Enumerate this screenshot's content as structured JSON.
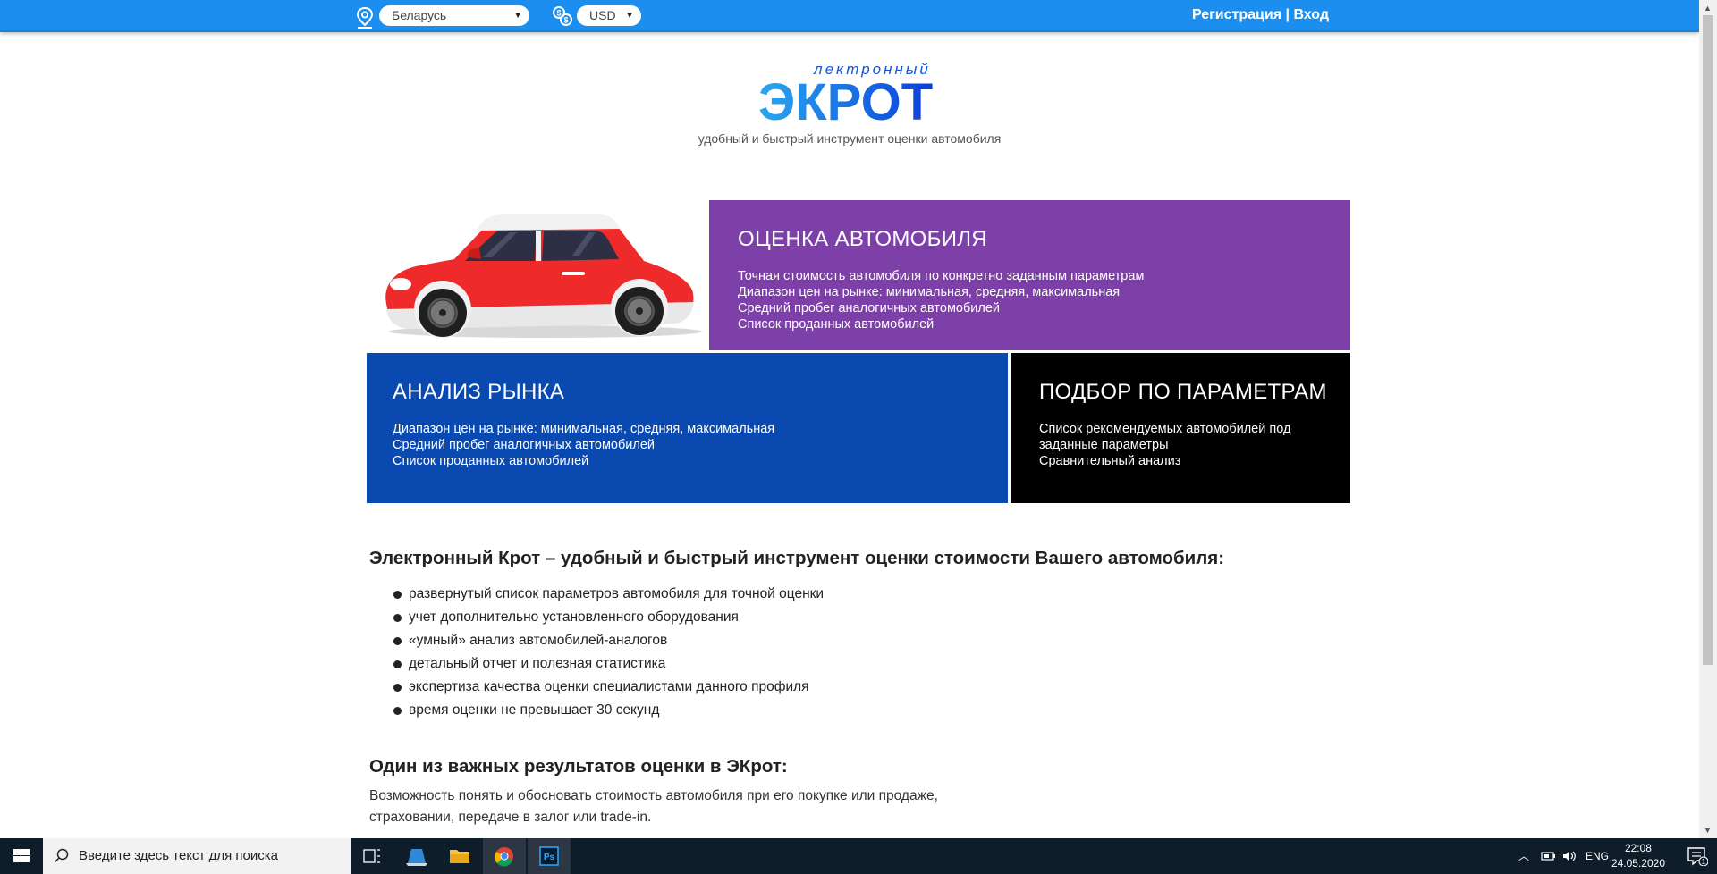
{
  "topbar": {
    "country": "Беларусь",
    "currency": "USD",
    "register_label": "Регистрация",
    "separator": " | ",
    "login_label": "Вход"
  },
  "logo": {
    "small_text": "лектронный",
    "big_text": "ЭКРОТ",
    "tagline": "удобный и быстрый инструмент оценки автомобиля"
  },
  "tiles": [
    {
      "title": "ОЦЕНКА АВТОМОБИЛЯ",
      "lines": [
        "Точная стоимость автомобиля по конкретно заданным параметрам",
        "Диапазон цен на рынке: минимальная, средняя, максимальная",
        "Средний пробег аналогичных автомобилей",
        "Список проданных автомобилей"
      ],
      "color": "#7d3fa8"
    },
    {
      "title": "АНАЛИЗ РЫНКА",
      "lines": [
        "Диапазон цен на рынке: минимальная, средняя, максимальная",
        "Средний пробег аналогичных автомобилей",
        "Список проданных автомобилей"
      ],
      "color": "#0a49b0"
    },
    {
      "title": "ПОДБОР ПО ПАРАМЕТРАМ",
      "lines": [
        "Список рекомендуемых автомобилей под",
        "заданные параметры",
        "Сравнительный анализ"
      ],
      "color": "#000000"
    }
  ],
  "content": {
    "heading1": "Электронный Крот – удобный и быстрый инструмент оценки стоимости Вашего автомобиля:",
    "features": [
      "развернутый список параметров автомобиля для точной оценки",
      "учет дополнительно установленного оборудования",
      "«умный» анализ автомобилей-аналогов",
      "детальный отчет и полезная статистика",
      "экспертиза качества оценки специалистами данного профиля",
      "время оценки не превышает 30 секунд"
    ],
    "heading2": "Один из важных результатов оценки в ЭКрот:",
    "paragraph_line1": "Возможность понять и обосновать стоимость автомобиля при его покупке или продаже,",
    "paragraph_line2": "страховании, передаче в залог или trade-in."
  },
  "taskbar": {
    "search_placeholder": "Введите здесь текст для поиска",
    "language": "ENG",
    "time": "22:08",
    "date": "24.05.2020",
    "notification_count": "1"
  },
  "colors": {
    "topbar": "#1c8ef0",
    "logo_blue": "#1579e6",
    "taskbar": "#0f1c2a"
  }
}
